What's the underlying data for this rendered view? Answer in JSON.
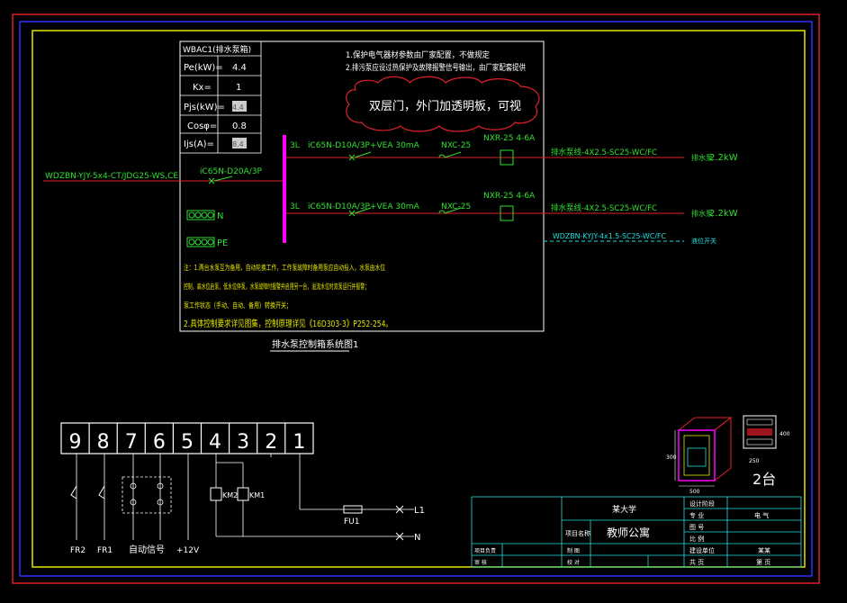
{
  "colors": {
    "frame_red": "#e0202a",
    "frame_blue": "#3030ff",
    "frame_yellow": "#e6e600",
    "white": "#ffffff",
    "green": "#30e030",
    "magenta": "#ff00ff",
    "red": "#ff2020",
    "cyan": "#20e0e0",
    "pink": "#ff6080"
  },
  "params": {
    "title": "WBAC1(排水泵箱)",
    "rows": [
      {
        "label": "Pe(kW)=",
        "value": "4.4"
      },
      {
        "label": "Kx=",
        "value": "1"
      },
      {
        "label": "Pjs(kW)=",
        "value": "4.4"
      },
      {
        "label": "Cosφ=",
        "value": "0.8"
      },
      {
        "label": "Ijs(A)=",
        "value": "8.4"
      }
    ]
  },
  "notes_top": [
    "1.保护电气器材参数由厂家配置，不做规定",
    "2.排污泵应设过热保护及故障报警信号输出，由厂家配套提供"
  ],
  "cloud_note": "双层门，外门加透明板，可视",
  "feeder": {
    "incoming": "WDZBN-YJY-5x4-CT/JDG25-WS,CE",
    "main_breaker": "iC65N-D20A/3P",
    "n_label": "N",
    "pe_label": "PE"
  },
  "circuits": [
    {
      "phase": "3L",
      "breaker": "iC65N-D10A/3P+VEA 30mA",
      "contactor": "NXC-25",
      "relay": "NXR-25 4-6A",
      "cable": "排水泵线-4X2.5-SC25-WC/FC",
      "load_label": "排水泵",
      "load": "2.2kW"
    },
    {
      "phase": "3L",
      "breaker": "iC65N-D10A/3P+VEA 30mA",
      "contactor": "NXC-25",
      "relay": "NXR-25 4-6A",
      "cable": "排水泵线-4X2.5-SC25-WC/FC",
      "load_label": "排水泵",
      "load": "2.2kW"
    }
  ],
  "control_cable": {
    "cable": "WDZBN-KYJY-4x1.5-SC25-WC/FC",
    "label": "液位开关"
  },
  "notes_bottom": [
    "注：1.两台水泵互为备用，自动轮换工作，工作泵故障时备用泵应自动投入，水泵由水位",
    "控制，高水位启泵，低水位停泵，水泵故障时报警并启用另一台，溢流水位时双泵运行并报警；",
    "泵工作状态（手动、自动、备用）转换开关；",
    "2.具体控制要求详见图集，控制原理详见《16D303-3》P252-254。"
  ],
  "diagram_caption": "排水泵控制箱系统图1",
  "terminals": [
    "9",
    "8",
    "7",
    "6",
    "5",
    "4",
    "3",
    "2",
    "1"
  ],
  "schematic": {
    "fr2": "FR2",
    "fr1": "FR1",
    "auto_signal": "自动信号",
    "plus12v": "+12V",
    "km2": "KM2",
    "km1": "KM1",
    "fu1": "FU1",
    "l1": "L1",
    "n": "N"
  },
  "cabinet": {
    "qty": "2台",
    "dim_w": "500",
    "dim_h": "300",
    "dim_side": "250",
    "dim_h2": "400"
  },
  "title_block": {
    "school": "某大学",
    "project_label": "项目名称",
    "project": "教师公寓",
    "design_unit": "设计阶段",
    "major_label": "专 业",
    "major": "电 气",
    "draw_no_label": "图 号",
    "scale_label": "比 例",
    "date_label": "日 期",
    "unit_label": "建设单位",
    "unit": "某某",
    "page_label": "共 页",
    "page2_label": "第 页",
    "leader": "项目负责",
    "check": "审 核",
    "draw": "制 图",
    "proof": "校 对"
  }
}
